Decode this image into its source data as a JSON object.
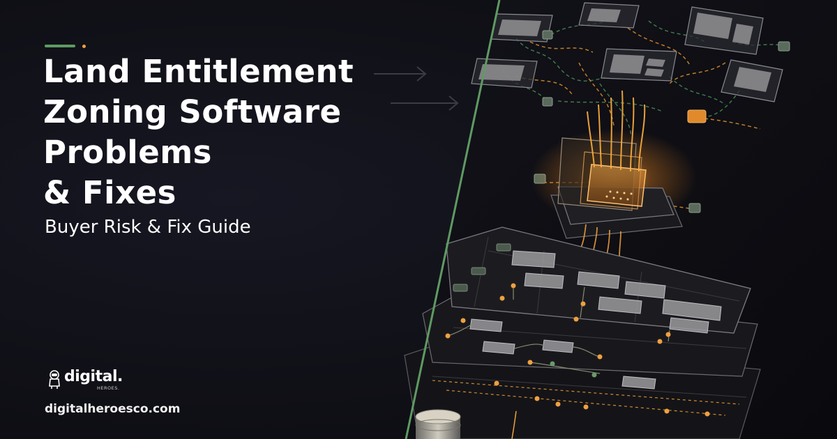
{
  "colors": {
    "background": "#101017",
    "accent_green": "#5f9a63",
    "accent_orange": "#f0a040",
    "text": "#ffffff"
  },
  "headline": {
    "lines": [
      "Land Entitlement",
      "Zoning Software",
      "Problems",
      "& Fixes"
    ]
  },
  "subtitle": "Buyer Risk & Fix Guide",
  "brand": {
    "wordmark": "digital.",
    "submark": "HEROES.",
    "website": "digitalheroesco.com"
  },
  "icons": [
    "astronaut-logo-icon",
    "arrow-right-icon"
  ]
}
